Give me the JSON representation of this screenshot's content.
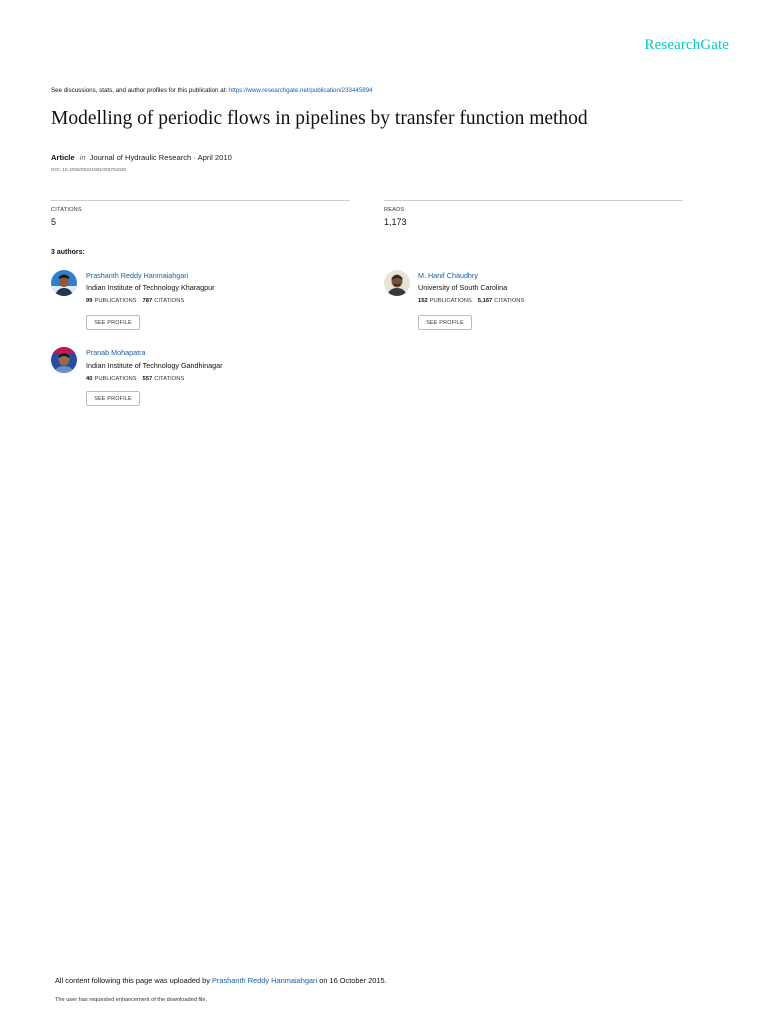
{
  "brand": {
    "name": "ResearchGate",
    "color": "#00ccbb"
  },
  "header": {
    "discuss_text": "See discussions, stats, and author profiles for this publication at:",
    "discuss_url": "https://www.researchgate.net/publication/233445894"
  },
  "paper": {
    "title": "Modelling of periodic flows in pipelines by transfer function method",
    "type": "Article",
    "in": "in",
    "journal": "Journal of Hydraulic Research · April 2010",
    "doi": "DOI: 10.1080/00221681003704020"
  },
  "stats": {
    "citations_label": "CITATIONS",
    "citations_value": "5",
    "reads_label": "READS",
    "reads_value": "1,173"
  },
  "authors_heading": "3 authors:",
  "authors": [
    {
      "name": "Prashanth Reddy Hanmaiahgari",
      "institution": "Indian Institute of Technology Kharagpur",
      "publications": "99",
      "publications_label": "PUBLICATIONS",
      "citations": "787",
      "citations_label": "CITATIONS",
      "button": "SEE PROFILE"
    },
    {
      "name": "M. Hanif Chaudhry",
      "institution": "University of South Carolina",
      "publications": "152",
      "publications_label": "PUBLICATIONS",
      "citations": "5,167",
      "citations_label": "CITATIONS",
      "button": "SEE PROFILE"
    },
    {
      "name": "Pranab Mohapatra",
      "institution": "Indian Institute of Technology Gandhinagar",
      "publications": "40",
      "publications_label": "PUBLICATIONS",
      "citations": "557",
      "citations_label": "CITATIONS",
      "button": "SEE PROFILE"
    }
  ],
  "footer": {
    "upload_prefix": "All content following this page was uploaded by",
    "uploader": "Prashanth Reddy Hanmaiahgari",
    "upload_suffix": "on 16 October 2015.",
    "note": "The user has requested enhancement of the downloaded file."
  }
}
